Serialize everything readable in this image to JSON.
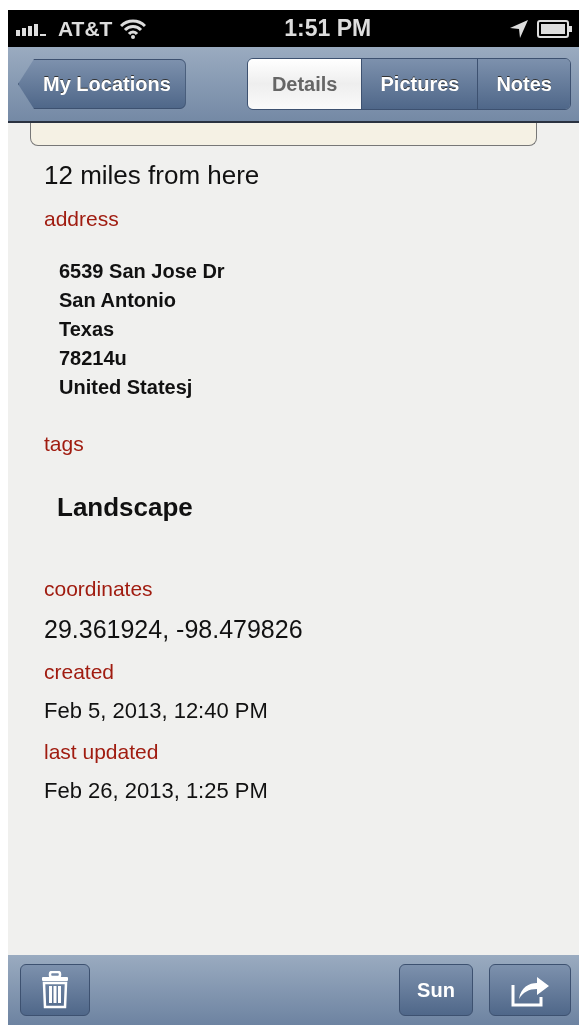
{
  "status_bar": {
    "carrier": "AT&T",
    "time": "1:51 PM"
  },
  "nav": {
    "back": "My Locations",
    "tabs": [
      {
        "label": "Details",
        "selected": true
      },
      {
        "label": "Pictures",
        "selected": false
      },
      {
        "label": "Notes",
        "selected": false
      }
    ]
  },
  "distance": "12 miles from here",
  "sections": [
    {
      "kind": "lines",
      "label": "address",
      "lines": [
        "6539 San Jose Dr",
        "San Antonio",
        "Texas",
        "78214u",
        "United Statesj"
      ]
    },
    {
      "kind": "tag",
      "label": "tags",
      "lines": [
        "Landscape"
      ]
    },
    {
      "kind": "plain",
      "label": "coordinates",
      "lines": [
        "29.361924, -98.479826"
      ]
    },
    {
      "kind": "plain",
      "label": "created",
      "lines": [
        "Feb 5, 2013, 12:40 PM"
      ]
    },
    {
      "kind": "plain",
      "label": "last updated",
      "lines": [
        "Feb 26, 2013, 1:25 PM"
      ]
    }
  ],
  "toolbar": {
    "sun": "Sun"
  }
}
